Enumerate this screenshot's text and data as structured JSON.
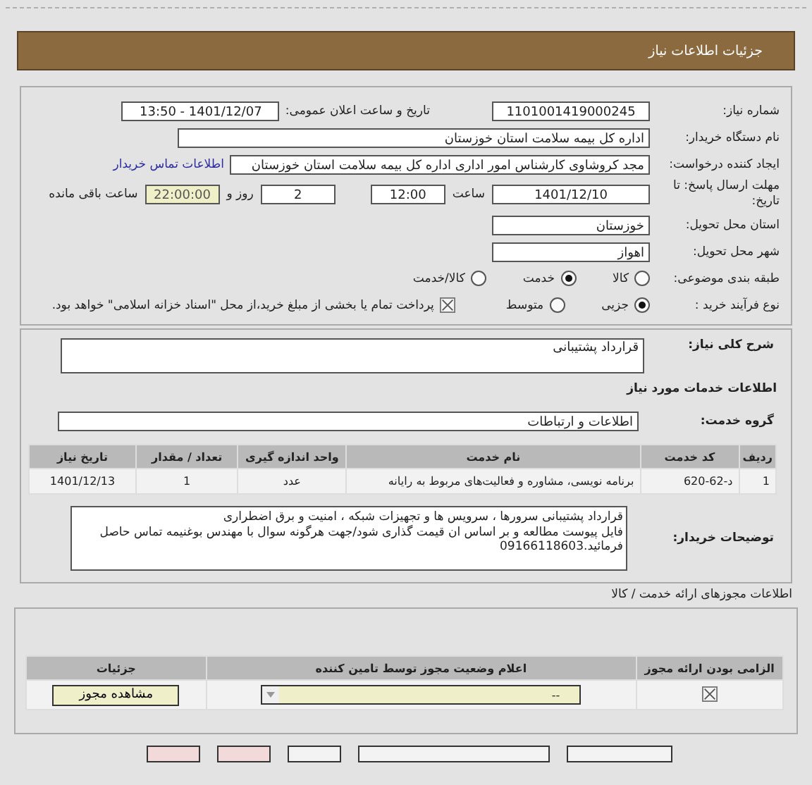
{
  "header": {
    "title": "جزئیات اطلاعات نیاز"
  },
  "need_number": {
    "label": "شماره نیاز:",
    "value": "1101001419000245"
  },
  "announce_date": {
    "label": "تاریخ و ساعت اعلان عمومی:",
    "value": "1401/12/07 - 13:50"
  },
  "buyer": {
    "label": "نام دستگاه خریدار:",
    "value": "اداره کل بیمه سلامت استان خوزستان"
  },
  "requester": {
    "label": "ایجاد کننده درخواست:",
    "value": "مجد کروشاوی کارشناس امور اداری اداره کل بیمه سلامت استان خوزستان",
    "link": "اطلاعات تماس خریدار"
  },
  "deadline": {
    "label": "مهلت ارسال پاسخ: تا تاریخ:",
    "date": "1401/12/10",
    "time_label": "ساعت",
    "time": "12:00",
    "days": "2",
    "days_label": "روز و",
    "remaining": "22:00:00",
    "remaining_label": "ساعت باقی مانده"
  },
  "province": {
    "label": "استان محل تحویل:",
    "value": "خوزستان"
  },
  "city": {
    "label": "شهر محل تحویل:",
    "value": "اهواز"
  },
  "category": {
    "label": "طبقه بندی موضوعی:",
    "options": [
      {
        "label": "کالا",
        "selected": false
      },
      {
        "label": "خدمت",
        "selected": true
      },
      {
        "label": "کالا/خدمت",
        "selected": false
      }
    ]
  },
  "process": {
    "label": "نوع فرآیند خرید :",
    "options": [
      {
        "label": "جزیی",
        "selected": true
      },
      {
        "label": "متوسط",
        "selected": false
      }
    ],
    "payment": {
      "label": "پرداخت تمام یا بخشی از مبلغ خرید،از محل \"اسناد خزانه اسلامی\" خواهد بود.",
      "checked": true
    }
  },
  "description": {
    "label": "شرح کلی نیاز:",
    "value": "قرارداد پشتیبانی"
  },
  "services_heading": "اطلاعات خدمات مورد نیاز",
  "service_group": {
    "label": "گروه خدمت:",
    "value": "اطلاعات و ارتباطات"
  },
  "table": {
    "columns": [
      "ردیف",
      "کد خدمت",
      "نام خدمت",
      "واحد اندازه گیری",
      "تعداد / مقدار",
      "تاریخ نیاز"
    ],
    "rows": [
      [
        "1",
        "د-62-620",
        "برنامه نویسی، مشاوره و فعالیت‌های مربوط به رایانه",
        "عدد",
        "1",
        "1401/12/13"
      ]
    ]
  },
  "buyer_notes": {
    "label": "توضیحات خریدار:",
    "value": "قرارداد پشتیبانی سرورها ، سرویس ها و تجهیزات شبکه ، امنیت و برق اضطراری\nفایل پیوست مطالعه و بر اساس ان قیمت گذاری شود/جهت هرگونه سوال با مهندس بوغنیمه تماس حاصل فرمائید.09166118603"
  },
  "licenses": {
    "title": "اطلاعات مجوزهای ارائه خدمت / کالا",
    "columns": [
      "الزامی بودن ارائه مجوز",
      "اعلام وضعیت مجوز توسط تامین کننده",
      "جزئیات"
    ],
    "rows": [
      {
        "required": true,
        "status": "--",
        "button": "مشاهده مجوز"
      }
    ]
  },
  "bottom_buttons": [
    {
      "kind": "plain"
    },
    {
      "kind": "plain"
    },
    {
      "kind": "plain"
    },
    {
      "kind": "alert"
    },
    {
      "kind": "alert"
    }
  ]
}
